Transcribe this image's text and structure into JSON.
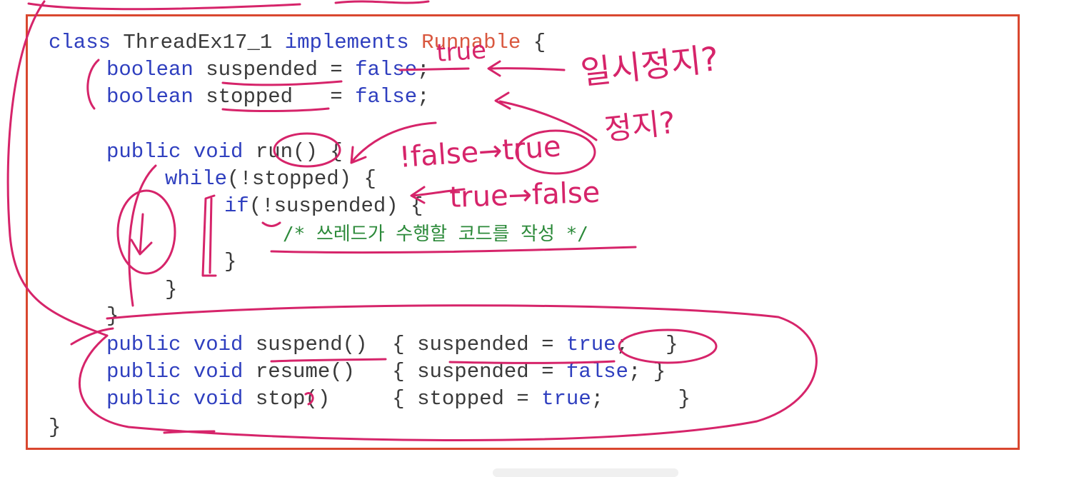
{
  "code": {
    "l1": {
      "a": "class ",
      "b": "ThreadEx17_1 ",
      "c": "implements ",
      "d": "Runnable",
      "e": " {"
    },
    "l2": {
      "a": "boolean ",
      "b": "suspended = ",
      "c": "false",
      "d": ";"
    },
    "l3": {
      "a": "boolean ",
      "b": "stopped   = ",
      "c": "false",
      "d": ";"
    },
    "l4": {
      "a": "public void ",
      "b": "run() {"
    },
    "l5": {
      "a": "while",
      "b": "(!stopped) {"
    },
    "l6": {
      "a": "if",
      "b": "(!suspended) {"
    },
    "l7": {
      "a": "/* 쓰레드가 수행할 코드를 작성 */"
    },
    "l8": {
      "a": "}"
    },
    "l9": {
      "a": "}"
    },
    "l10": {
      "a": "}"
    },
    "l11": {
      "a": "public void ",
      "b": "suspend()  { suspended = ",
      "c": "true",
      "d": ";   }"
    },
    "l12": {
      "a": "public void ",
      "b": "resume()   { suspended = ",
      "c": "false",
      "d": "; }"
    },
    "l13": {
      "a": "public void ",
      "b": "stop()     { stopped = ",
      "c": "true",
      "d": ";      }"
    },
    "l14": {
      "a": "}"
    }
  },
  "annotations": {
    "n1": "true",
    "n2": "일시정지?",
    "n3": "정지?",
    "n4": "!false→true",
    "n5": "true→false"
  },
  "colors": {
    "keyword": "#2f3fbf",
    "type": "#d9583f",
    "comment": "#2c8a3a",
    "ink": "#d6246a",
    "frame": "#d9472f"
  }
}
